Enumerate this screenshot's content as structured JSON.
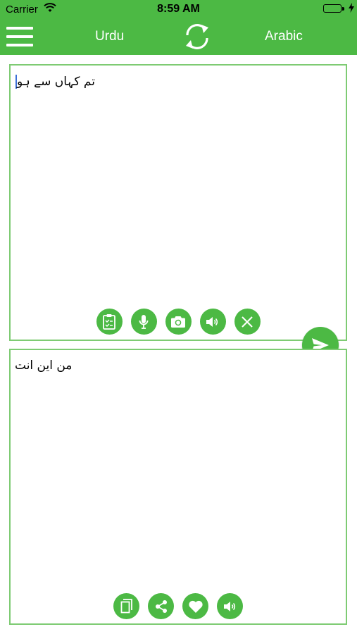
{
  "status_bar": {
    "carrier": "Carrier",
    "time": "8:59 AM",
    "battery_level": 1.0
  },
  "navbar": {
    "menu_icon": "hamburger-menu-icon",
    "source_language": "Urdu",
    "target_language": "Arabic",
    "swap_icon": "swap-arrows-icon"
  },
  "input_panel": {
    "text": "تم کہاں سے ہو",
    "tools": [
      {
        "name": "paste-button",
        "icon": "clipboard-icon"
      },
      {
        "name": "voice-input-button",
        "icon": "microphone-icon"
      },
      {
        "name": "camera-button",
        "icon": "camera-icon"
      },
      {
        "name": "speak-input-button",
        "icon": "speaker-icon"
      },
      {
        "name": "clear-button",
        "icon": "close-icon"
      }
    ]
  },
  "send_icon": "send-icon",
  "output_panel": {
    "text": "من اين انت",
    "tools": [
      {
        "name": "copy-button",
        "icon": "copy-icon"
      },
      {
        "name": "share-button",
        "icon": "share-icon"
      },
      {
        "name": "favorite-button",
        "icon": "heart-icon"
      },
      {
        "name": "speak-output-button",
        "icon": "speaker-icon"
      }
    ]
  },
  "colors": {
    "primary": "#4cb944",
    "panel_border": "#7ecb73",
    "caret": "#3b6fd8"
  }
}
